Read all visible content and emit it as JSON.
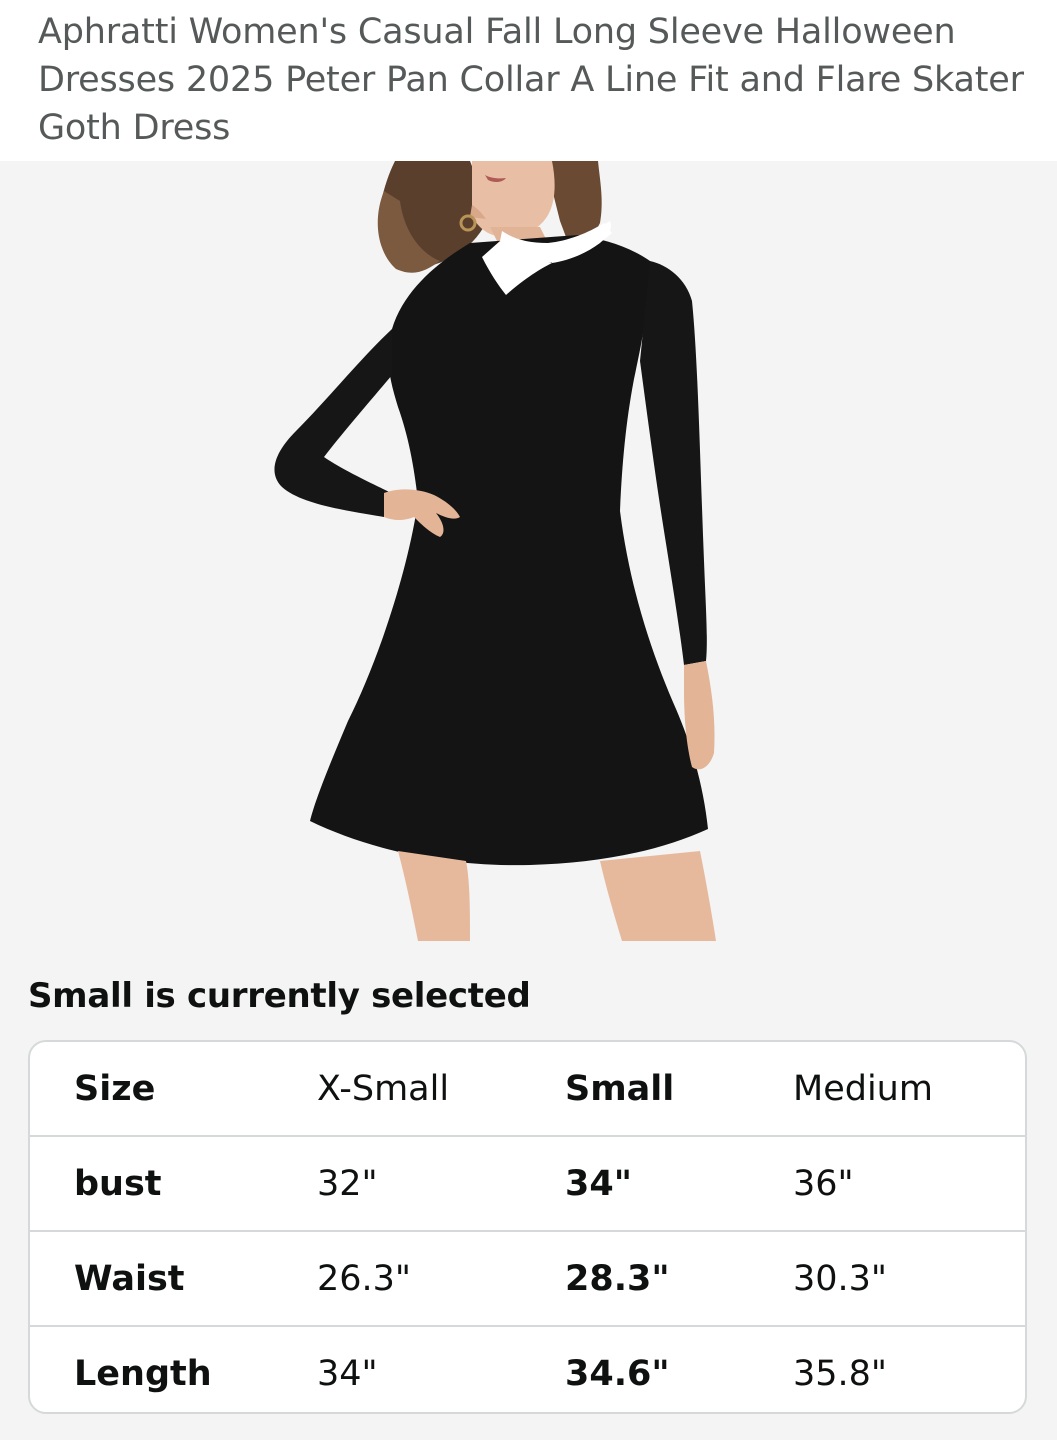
{
  "product": {
    "title": "Aphratti Women's Casual Fall Long Sleeve Halloween Dresses 2025 Peter Pan Collar A Line Fit and Flare Skater Goth Dress",
    "image_alt": "Model wearing black long sleeve dress with white Peter Pan collar"
  },
  "selection": {
    "caption": "Small is currently selected"
  },
  "size_table": {
    "header": [
      "Size",
      "X-Small",
      "Small",
      "Medium"
    ],
    "rows": [
      [
        "bust",
        "32\"",
        "34\"",
        "36\""
      ],
      [
        "Waist",
        "26.3\"",
        "28.3\"",
        "30.3\""
      ],
      [
        "Length",
        "34\"",
        "34.6\"",
        "35.8\""
      ]
    ],
    "selected_column": "Small"
  },
  "colors": {
    "title_text": "#565959",
    "border": "#d5d9d9",
    "image_background": "#f4f4f4",
    "dress": "#141414",
    "collar": "#ffffff"
  }
}
